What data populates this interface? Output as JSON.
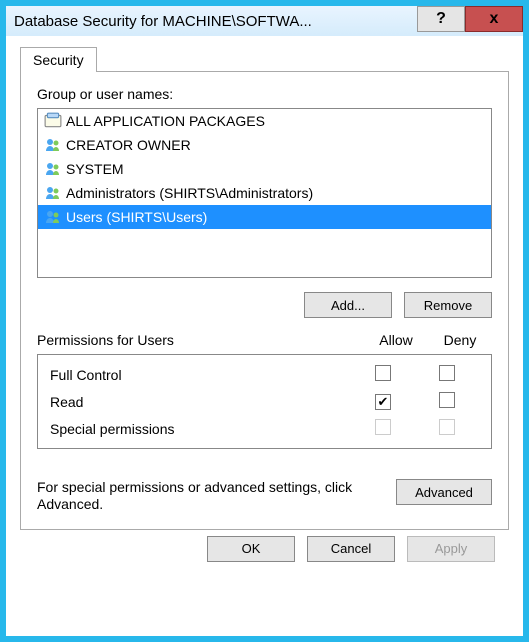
{
  "titlebar": {
    "title": "Database Security for MACHINE\\SOFTWA...",
    "help": "?",
    "close": "x"
  },
  "tab": {
    "label": "Security"
  },
  "groups_label": "Group or user names:",
  "groups": [
    {
      "name": "ALL APPLICATION PACKAGES",
      "icon": "pkg"
    },
    {
      "name": "CREATOR OWNER",
      "icon": "group"
    },
    {
      "name": "SYSTEM",
      "icon": "group"
    },
    {
      "name": "Administrators (SHIRTS\\Administrators)",
      "icon": "group"
    },
    {
      "name": "Users (SHIRTS\\Users)",
      "icon": "group"
    }
  ],
  "buttons": {
    "add": "Add...",
    "remove": "Remove",
    "advanced": "Advanced",
    "ok": "OK",
    "cancel": "Cancel",
    "apply": "Apply"
  },
  "perm_header": {
    "label": "Permissions for Users",
    "allow": "Allow",
    "deny": "Deny"
  },
  "permissions": [
    {
      "name": "Full Control",
      "allow": false,
      "deny": false,
      "enabled": true
    },
    {
      "name": "Read",
      "allow": true,
      "deny": false,
      "enabled": true
    },
    {
      "name": "Special permissions",
      "allow": false,
      "deny": false,
      "enabled": false
    }
  ],
  "advanced_text": "For special permissions or advanced settings, click Advanced."
}
